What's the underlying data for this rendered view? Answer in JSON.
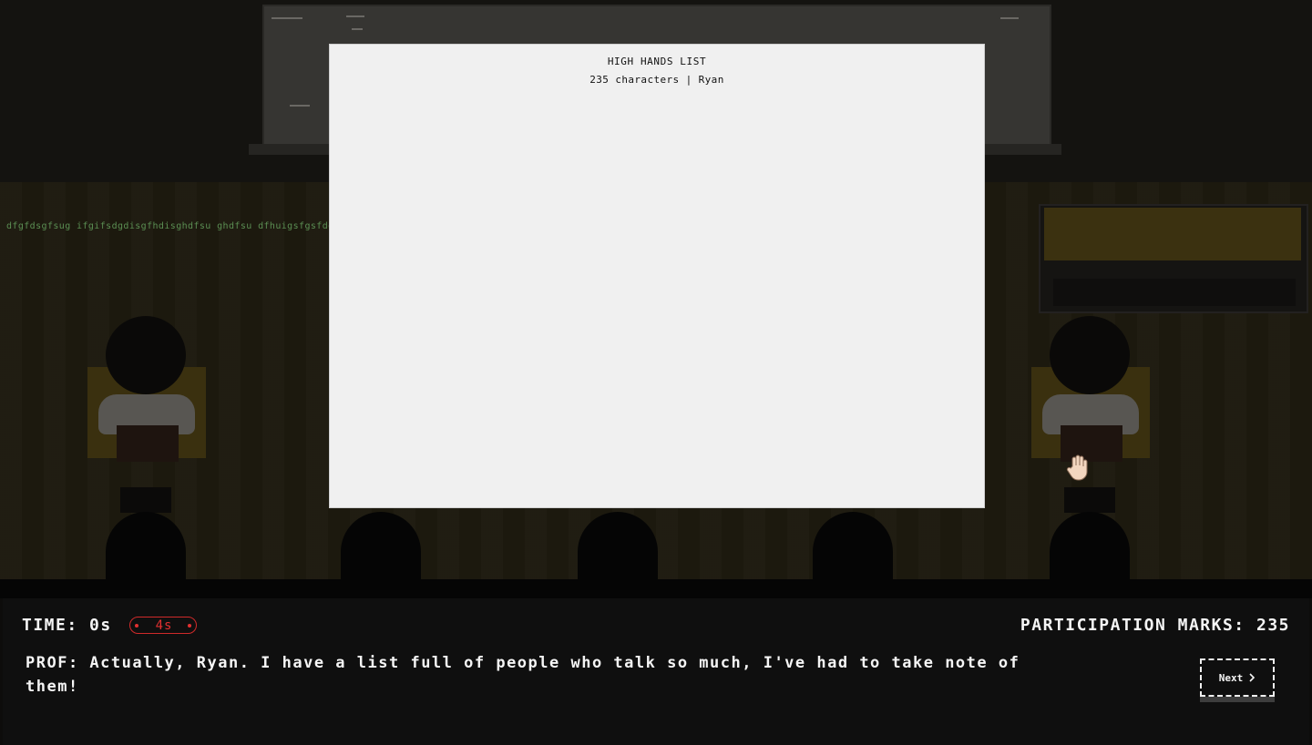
{
  "chat_stream": "dfgfdsgfsug ifgifsdgdisgfhdisghdfsu ghdfsu dfhuigsfgsfdgfs",
  "modal": {
    "title": "HIGH HANDS LIST",
    "subtitle": "235 characters | Ryan"
  },
  "hud": {
    "time_label": "TIME: 0s",
    "timer_badge": "4s",
    "participation": "PARTICIPATION MARKS: 235",
    "dialogue": "PROF: Actually, Ryan. I have a list full of people who talk so much, I've had to take note of them!",
    "next_label": "Next"
  },
  "icons": {
    "raised_hand": "raised-hand-icon",
    "next": "chevron-right-icon"
  },
  "colors": {
    "chat_text": "#5b8f53",
    "timer_red": "#e23030",
    "modal_bg": "#f0f0f0",
    "hud_bg": "#0f0f0f"
  }
}
